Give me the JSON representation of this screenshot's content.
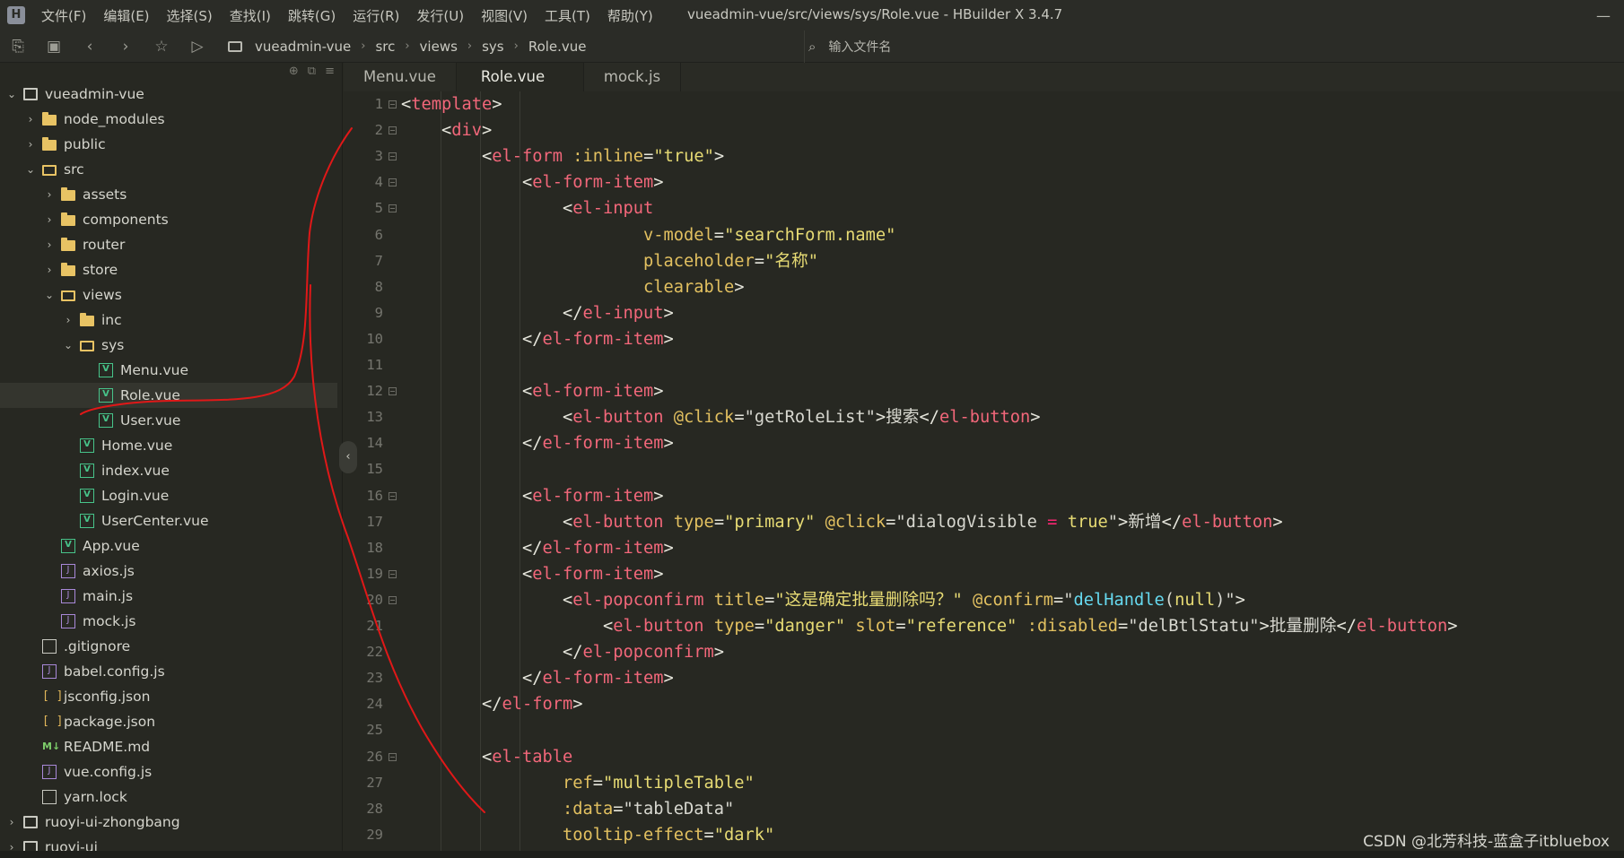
{
  "app": {
    "menus": [
      "文件(F)",
      "编辑(E)",
      "选择(S)",
      "查找(I)",
      "跳转(G)",
      "运行(R)",
      "发行(U)",
      "视图(V)",
      "工具(T)",
      "帮助(Y)"
    ],
    "window_title": "vueadmin-vue/src/views/sys/Role.vue - HBuilder X 3.4.7"
  },
  "toolbar": {
    "breadcrumb": [
      "vueadmin-vue",
      "src",
      "views",
      "sys",
      "Role.vue"
    ],
    "file_search_placeholder": "输入文件名"
  },
  "sidebar": {
    "tree": [
      {
        "label": "vueadmin-vue",
        "icon": "project",
        "depth": 0,
        "expanded": true
      },
      {
        "label": "node_modules",
        "icon": "folder",
        "depth": 1,
        "expanded": false
      },
      {
        "label": "public",
        "icon": "folder",
        "depth": 1,
        "expanded": false
      },
      {
        "label": "src",
        "icon": "folder-open",
        "depth": 1,
        "expanded": true
      },
      {
        "label": "assets",
        "icon": "folder",
        "depth": 2,
        "expanded": false
      },
      {
        "label": "components",
        "icon": "folder",
        "depth": 2,
        "expanded": false
      },
      {
        "label": "router",
        "icon": "folder",
        "depth": 2,
        "expanded": false
      },
      {
        "label": "store",
        "icon": "folder",
        "depth": 2,
        "expanded": false
      },
      {
        "label": "views",
        "icon": "folder-open",
        "depth": 2,
        "expanded": true
      },
      {
        "label": "inc",
        "icon": "folder",
        "depth": 3,
        "expanded": false
      },
      {
        "label": "sys",
        "icon": "folder-open",
        "depth": 3,
        "expanded": true
      },
      {
        "label": "Menu.vue",
        "icon": "vue",
        "depth": 4
      },
      {
        "label": "Role.vue",
        "icon": "vue",
        "depth": 4,
        "selected": true
      },
      {
        "label": "User.vue",
        "icon": "vue",
        "depth": 4
      },
      {
        "label": "Home.vue",
        "icon": "vue",
        "depth": 3
      },
      {
        "label": "index.vue",
        "icon": "vue",
        "depth": 3
      },
      {
        "label": "Login.vue",
        "icon": "vue",
        "depth": 3
      },
      {
        "label": "UserCenter.vue",
        "icon": "vue",
        "depth": 3
      },
      {
        "label": "App.vue",
        "icon": "vue",
        "depth": 2
      },
      {
        "label": "axios.js",
        "icon": "js",
        "depth": 2
      },
      {
        "label": "main.js",
        "icon": "js",
        "depth": 2
      },
      {
        "label": "mock.js",
        "icon": "js",
        "depth": 2
      },
      {
        "label": ".gitignore",
        "icon": "file",
        "depth": 1
      },
      {
        "label": "babel.config.js",
        "icon": "js",
        "depth": 1
      },
      {
        "label": "jsconfig.json",
        "icon": "json",
        "depth": 1
      },
      {
        "label": "package.json",
        "icon": "json",
        "depth": 1
      },
      {
        "label": "README.md",
        "icon": "md",
        "depth": 1
      },
      {
        "label": "vue.config.js",
        "icon": "js",
        "depth": 1
      },
      {
        "label": "yarn.lock",
        "icon": "file",
        "depth": 1
      },
      {
        "label": "ruoyi-ui-zhongbang",
        "icon": "project",
        "depth": 0,
        "expanded": false
      },
      {
        "label": "ruoyi-ui",
        "icon": "project",
        "depth": 0,
        "expanded": false
      }
    ]
  },
  "editor": {
    "tabs": [
      {
        "label": "Menu.vue",
        "active": false
      },
      {
        "label": "Role.vue",
        "active": true
      },
      {
        "label": "mock.js",
        "active": false
      }
    ],
    "lines": [
      {
        "n": "1",
        "fold": true,
        "tokens": [
          [
            "p",
            "<"
          ],
          [
            "tag",
            "template"
          ],
          [
            "p",
            ">"
          ]
        ]
      },
      {
        "n": "2",
        "fold": true,
        "tokens": [
          [
            "p",
            "    <"
          ],
          [
            "tag",
            "div"
          ],
          [
            "p",
            ">"
          ]
        ]
      },
      {
        "n": "3",
        "fold": true,
        "tokens": [
          [
            "p",
            "        <"
          ],
          [
            "tag",
            "el-form"
          ],
          [
            "p",
            " "
          ],
          [
            "attr",
            ":inline"
          ],
          [
            "p",
            "="
          ],
          [
            "str",
            "\"true\""
          ],
          [
            "p",
            ">"
          ]
        ]
      },
      {
        "n": "4",
        "fold": true,
        "tokens": [
          [
            "p",
            "            <"
          ],
          [
            "tag",
            "el-form-item"
          ],
          [
            "p",
            ">"
          ]
        ]
      },
      {
        "n": "5",
        "fold": true,
        "tokens": [
          [
            "p",
            "                <"
          ],
          [
            "tag",
            "el-input"
          ]
        ]
      },
      {
        "n": "6",
        "fold": false,
        "tokens": [
          [
            "p",
            "                        "
          ],
          [
            "attr",
            "v-model"
          ],
          [
            "p",
            "="
          ],
          [
            "str",
            "\"searchForm.name\""
          ]
        ]
      },
      {
        "n": "7",
        "fold": false,
        "tokens": [
          [
            "p",
            "                        "
          ],
          [
            "attr",
            "placeholder"
          ],
          [
            "p",
            "="
          ],
          [
            "str",
            "\"名称\""
          ]
        ]
      },
      {
        "n": "8",
        "fold": false,
        "tokens": [
          [
            "p",
            "                        "
          ],
          [
            "attr",
            "clearable"
          ],
          [
            "p",
            ">"
          ]
        ]
      },
      {
        "n": "9",
        "fold": false,
        "tokens": [
          [
            "p",
            "                </"
          ],
          [
            "tag",
            "el-input"
          ],
          [
            "p",
            ">"
          ]
        ]
      },
      {
        "n": "10",
        "fold": false,
        "tokens": [
          [
            "p",
            "            </"
          ],
          [
            "tag",
            "el-form-item"
          ],
          [
            "p",
            ">"
          ]
        ]
      },
      {
        "n": "11",
        "fold": false,
        "tokens": []
      },
      {
        "n": "12",
        "fold": true,
        "tokens": [
          [
            "p",
            "            <"
          ],
          [
            "tag",
            "el-form-item"
          ],
          [
            "p",
            ">"
          ]
        ]
      },
      {
        "n": "13",
        "fold": false,
        "tokens": [
          [
            "p",
            "                <"
          ],
          [
            "tag",
            "el-button"
          ],
          [
            "p",
            " "
          ],
          [
            "attr",
            "@click"
          ],
          [
            "p",
            "="
          ],
          [
            "txt",
            "\"getRoleList\""
          ],
          [
            "p",
            ">"
          ],
          [
            "txt",
            "搜索"
          ],
          [
            "p",
            "</"
          ],
          [
            "tag",
            "el-button"
          ],
          [
            "p",
            ">"
          ]
        ]
      },
      {
        "n": "14",
        "fold": false,
        "tokens": [
          [
            "p",
            "            </"
          ],
          [
            "tag",
            "el-form-item"
          ],
          [
            "p",
            ">"
          ]
        ]
      },
      {
        "n": "15",
        "fold": false,
        "tokens": []
      },
      {
        "n": "16",
        "fold": true,
        "tokens": [
          [
            "p",
            "            <"
          ],
          [
            "tag",
            "el-form-item"
          ],
          [
            "p",
            ">"
          ]
        ]
      },
      {
        "n": "17",
        "fold": false,
        "tokens": [
          [
            "p",
            "                <"
          ],
          [
            "tag",
            "el-button"
          ],
          [
            "p",
            " "
          ],
          [
            "attr",
            "type"
          ],
          [
            "p",
            "="
          ],
          [
            "str",
            "\"primary\""
          ],
          [
            "p",
            " "
          ],
          [
            "attr",
            "@click"
          ],
          [
            "p",
            "="
          ],
          [
            "txt",
            "\"dialogVisible "
          ],
          [
            "op",
            "="
          ],
          [
            "txt",
            " "
          ],
          [
            "str",
            "true"
          ],
          [
            "txt",
            "\""
          ],
          [
            "p",
            ">"
          ],
          [
            "txt",
            "新增"
          ],
          [
            "p",
            "</"
          ],
          [
            "tag",
            "el-button"
          ],
          [
            "p",
            ">"
          ]
        ]
      },
      {
        "n": "18",
        "fold": false,
        "tokens": [
          [
            "p",
            "            </"
          ],
          [
            "tag",
            "el-form-item"
          ],
          [
            "p",
            ">"
          ]
        ]
      },
      {
        "n": "19",
        "fold": true,
        "tokens": [
          [
            "p",
            "            <"
          ],
          [
            "tag",
            "el-form-item"
          ],
          [
            "p",
            ">"
          ]
        ]
      },
      {
        "n": "20",
        "fold": true,
        "tokens": [
          [
            "p",
            "                <"
          ],
          [
            "tag",
            "el-popconfirm"
          ],
          [
            "p",
            " "
          ],
          [
            "attr",
            "title"
          ],
          [
            "p",
            "="
          ],
          [
            "str",
            "\"这是确定批量删除吗？\""
          ],
          [
            "p",
            " "
          ],
          [
            "attr",
            "@confirm"
          ],
          [
            "p",
            "="
          ],
          [
            "txt",
            "\""
          ],
          [
            "kw",
            "delHandle"
          ],
          [
            "txt",
            "("
          ],
          [
            "str",
            "null"
          ],
          [
            "txt",
            ")\""
          ],
          [
            "p",
            ">"
          ]
        ]
      },
      {
        "n": "21",
        "fold": false,
        "tokens": [
          [
            "p",
            "                    <"
          ],
          [
            "tag",
            "el-button"
          ],
          [
            "p",
            " "
          ],
          [
            "attr",
            "type"
          ],
          [
            "p",
            "="
          ],
          [
            "str",
            "\"danger\""
          ],
          [
            "p",
            " "
          ],
          [
            "attr",
            "slot"
          ],
          [
            "p",
            "="
          ],
          [
            "str",
            "\"reference\""
          ],
          [
            "p",
            " "
          ],
          [
            "attr",
            ":disabled"
          ],
          [
            "p",
            "="
          ],
          [
            "txt",
            "\"delBtlStatu\""
          ],
          [
            "p",
            ">"
          ],
          [
            "txt",
            "批量删除"
          ],
          [
            "p",
            "</"
          ],
          [
            "tag",
            "el-button"
          ],
          [
            "p",
            ">"
          ]
        ]
      },
      {
        "n": "22",
        "fold": false,
        "tokens": [
          [
            "p",
            "                </"
          ],
          [
            "tag",
            "el-popconfirm"
          ],
          [
            "p",
            ">"
          ]
        ]
      },
      {
        "n": "23",
        "fold": false,
        "tokens": [
          [
            "p",
            "            </"
          ],
          [
            "tag",
            "el-form-item"
          ],
          [
            "p",
            ">"
          ]
        ]
      },
      {
        "n": "24",
        "fold": false,
        "tokens": [
          [
            "p",
            "        </"
          ],
          [
            "tag",
            "el-form"
          ],
          [
            "p",
            ">"
          ]
        ]
      },
      {
        "n": "25",
        "fold": false,
        "tokens": []
      },
      {
        "n": "26",
        "fold": true,
        "tokens": [
          [
            "p",
            "        <"
          ],
          [
            "tag",
            "el-table"
          ]
        ]
      },
      {
        "n": "27",
        "fold": false,
        "tokens": [
          [
            "p",
            "                "
          ],
          [
            "attr",
            "ref"
          ],
          [
            "p",
            "="
          ],
          [
            "str",
            "\"multipleTable\""
          ]
        ]
      },
      {
        "n": "28",
        "fold": false,
        "tokens": [
          [
            "p",
            "                "
          ],
          [
            "attr",
            ":data"
          ],
          [
            "p",
            "="
          ],
          [
            "txt",
            "\"tableData\""
          ]
        ]
      },
      {
        "n": "29",
        "fold": false,
        "tokens": [
          [
            "p",
            "                "
          ],
          [
            "attr",
            "tooltip-effect"
          ],
          [
            "p",
            "="
          ],
          [
            "str",
            "\"dark\""
          ]
        ]
      }
    ]
  },
  "watermark": "CSDN @北芳科技-蓝盒子itbluebox",
  "colors": {
    "background": "#272822",
    "tag": "#f2677a",
    "attribute": "#e2c060",
    "string": "#e7db74",
    "annotation_stroke": "#e01818"
  }
}
